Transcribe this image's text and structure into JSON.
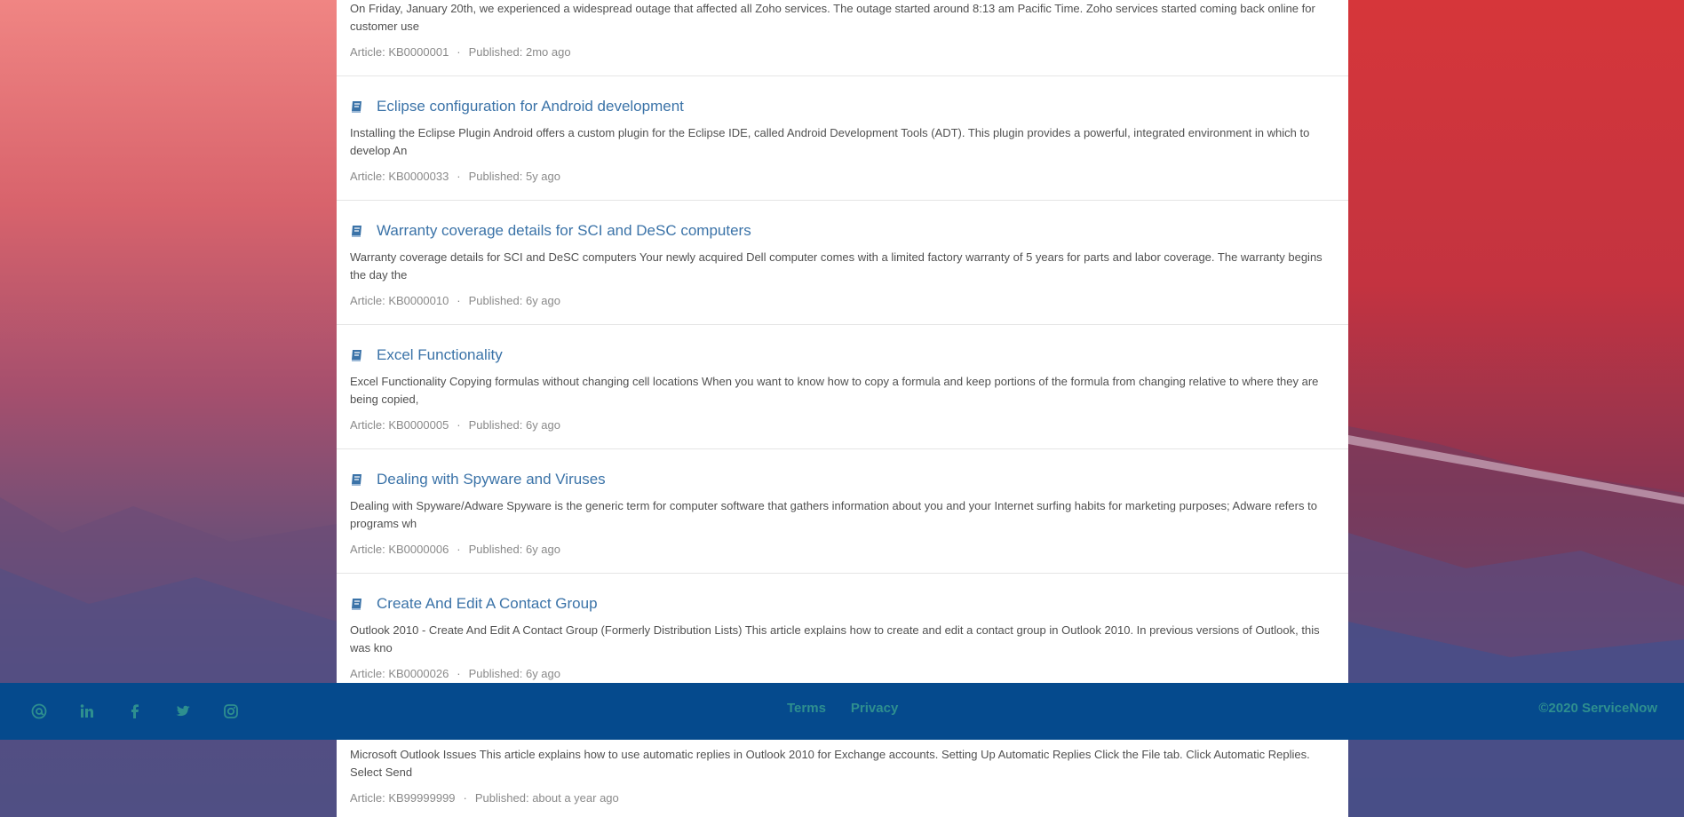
{
  "articles": [
    {
      "title": "",
      "summary": "On Friday, January 20th, we experienced a widespread outage that affected all Zoho services. The outage started around 8:13 am Pacific Time. Zoho services started coming back online for customer use",
      "article_label": "Article: KB0000001",
      "published_label": "Published: 2mo ago",
      "icon": "book-icon"
    },
    {
      "title": "Eclipse configuration for Android development",
      "summary": "Installing the Eclipse Plugin Android offers a custom plugin for the Eclipse IDE, called Android Development Tools (ADT). This plugin provides a powerful, integrated environment in which to develop An",
      "article_label": "Article: KB0000033",
      "published_label": "Published: 5y ago",
      "icon": "book-icon"
    },
    {
      "title": "Warranty coverage details for SCI and DeSC computers",
      "summary": "Warranty coverage details for SCI and DeSC computers Your newly acquired Dell computer comes with a limited factory warranty of 5 years for parts and labor coverage. The warranty begins the day the",
      "article_label": "Article: KB0000010",
      "published_label": "Published: 6y ago",
      "icon": "book-icon"
    },
    {
      "title": "Excel Functionality",
      "summary": "Excel Functionality Copying formulas without changing cell locations When you want to know how to copy a formula and keep portions of the formula from changing relative to where they are being copied,",
      "article_label": "Article: KB0000005",
      "published_label": "Published: 6y ago",
      "icon": "book-icon"
    },
    {
      "title": "Dealing with Spyware and Viruses",
      "summary": "Dealing with Spyware/Adware Spyware is the generic term for computer software that gathers information about you and your Internet surfing habits for marketing purposes; Adware refers to programs wh",
      "article_label": "Article: KB0000006",
      "published_label": "Published: 6y ago",
      "icon": "book-icon"
    },
    {
      "title": "Create And Edit A Contact Group",
      "summary": "Outlook 2010 - Create And Edit A Contact Group (Formerly Distribution Lists) This article explains how to create and edit a contact group in Outlook 2010. In previous versions of Outlook, this was kno",
      "article_label": "Article: KB0000026",
      "published_label": "Published: 6y ago",
      "icon": "book-icon"
    },
    {
      "title": "",
      "summary": "Microsoft Outlook Issues This article explains how to use automatic replies in Outlook 2010 for Exchange accounts. Setting Up Automatic Replies Click the File tab. Click Automatic Replies. Select Send",
      "article_label": "Article: KB99999999",
      "published_label": "Published: about a year ago",
      "icon": "book-icon"
    }
  ],
  "meta_separator": "·",
  "footer": {
    "social_icons": [
      "at-icon",
      "linkedin-icon",
      "facebook-icon",
      "twitter-icon",
      "instagram-icon"
    ],
    "links": [
      "Terms",
      "Privacy"
    ],
    "copyright": "©2020 ServiceNow"
  },
  "colors": {
    "link": "#3b73a8",
    "footer_bg": "#054a8d",
    "footer_text": "#2e8f8f"
  }
}
